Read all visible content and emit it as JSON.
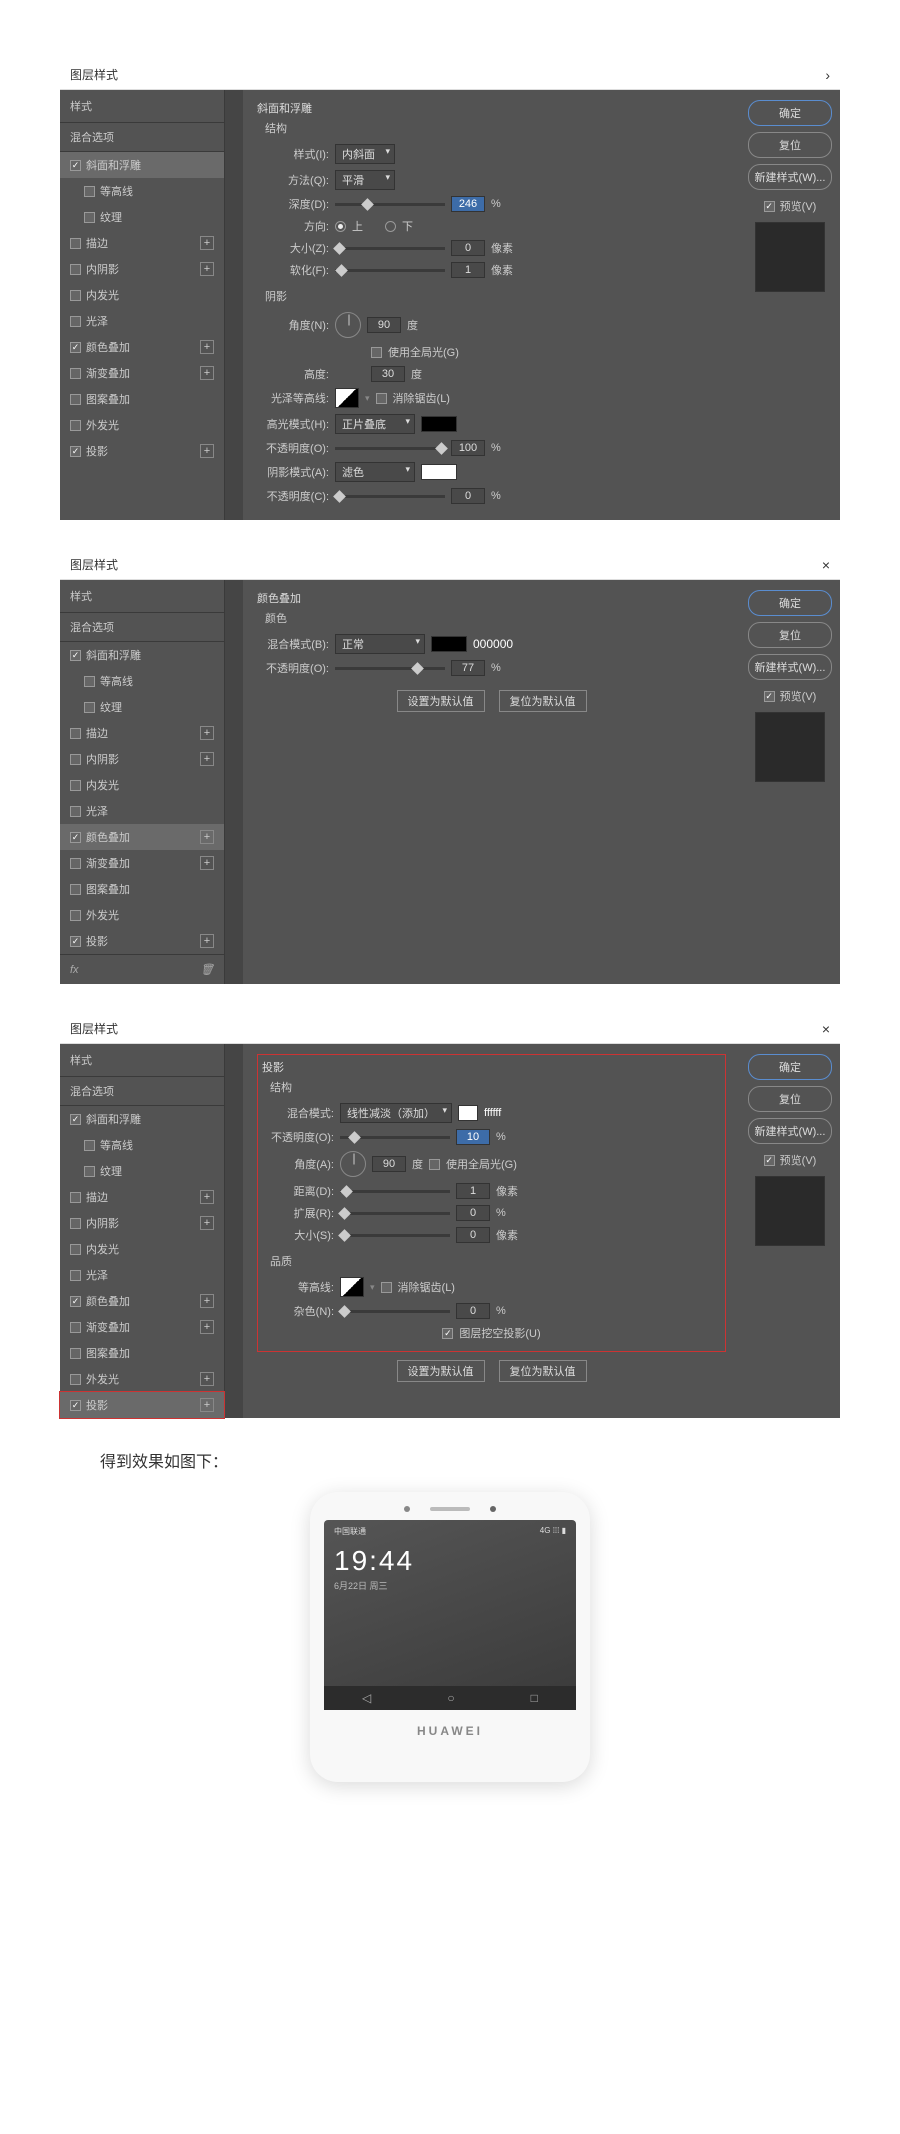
{
  "dialog1": {
    "title": "图层样式",
    "styles_header": "样式",
    "blend_options": "混合选项",
    "items": [
      {
        "label": "斜面和浮雕",
        "checked": true,
        "selected": true
      },
      {
        "label": "等高线",
        "checked": false,
        "indent": true
      },
      {
        "label": "纹理",
        "checked": false,
        "indent": true
      },
      {
        "label": "描边",
        "checked": false,
        "add": true
      },
      {
        "label": "内阴影",
        "checked": false,
        "add": true
      },
      {
        "label": "内发光",
        "checked": false
      },
      {
        "label": "光泽",
        "checked": false
      },
      {
        "label": "颜色叠加",
        "checked": true,
        "add": true
      },
      {
        "label": "渐变叠加",
        "checked": false,
        "add": true
      },
      {
        "label": "图案叠加",
        "checked": false
      },
      {
        "label": "外发光",
        "checked": false
      },
      {
        "label": "投影",
        "checked": true,
        "add": true
      }
    ],
    "panel_title": "斜面和浮雕",
    "structure_label": "结构",
    "style_label": "样式(I):",
    "style_value": "内斜面",
    "method_label": "方法(Q):",
    "method_value": "平滑",
    "depth_label": "深度(D):",
    "depth_value": "246",
    "depth_unit": "%",
    "direction_label": "方向:",
    "dir_up": "上",
    "dir_down": "下",
    "size_label": "大小(Z):",
    "size_value": "0",
    "size_unit": "像素",
    "soften_label": "软化(F):",
    "soften_value": "1",
    "soften_unit": "像素",
    "shadow_section": "阴影",
    "angle_label": "角度(N):",
    "angle_value": "90",
    "angle_unit": "度",
    "global_light": "使用全局光(G)",
    "altitude_label": "高度:",
    "altitude_value": "30",
    "altitude_unit": "度",
    "gloss_label": "光泽等高线:",
    "antialias": "消除锯齿(L)",
    "highlight_mode_label": "高光模式(H):",
    "highlight_mode_value": "正片叠底",
    "highlight_opacity_label": "不透明度(O):",
    "highlight_opacity_value": "100",
    "percent": "%",
    "shadow_mode_label": "阴影模式(A):",
    "shadow_mode_value": "滤色",
    "shadow_opacity_label": "不透明度(C):",
    "shadow_opacity_value": "0"
  },
  "dialog2": {
    "title": "图层样式",
    "items": [
      {
        "label": "斜面和浮雕",
        "checked": true
      },
      {
        "label": "等高线",
        "checked": false,
        "indent": true
      },
      {
        "label": "纹理",
        "checked": false,
        "indent": true
      },
      {
        "label": "描边",
        "checked": false,
        "add": true
      },
      {
        "label": "内阴影",
        "checked": false,
        "add": true
      },
      {
        "label": "内发光",
        "checked": false
      },
      {
        "label": "光泽",
        "checked": false
      },
      {
        "label": "颜色叠加",
        "checked": true,
        "selected": true,
        "add": true
      },
      {
        "label": "渐变叠加",
        "checked": false,
        "add": true
      },
      {
        "label": "图案叠加",
        "checked": false
      },
      {
        "label": "外发光",
        "checked": false
      },
      {
        "label": "投影",
        "checked": true,
        "add": true
      }
    ],
    "panel_title": "颜色叠加",
    "color_section": "颜色",
    "blend_mode_label": "混合模式(B):",
    "blend_mode_value": "正常",
    "color_code": "000000",
    "opacity_label": "不透明度(O):",
    "opacity_value": "77",
    "make_default": "设置为默认值",
    "reset_default": "复位为默认值",
    "fx_label": "fx"
  },
  "dialog3": {
    "title": "图层样式",
    "items": [
      {
        "label": "斜面和浮雕",
        "checked": true
      },
      {
        "label": "等高线",
        "checked": false,
        "indent": true
      },
      {
        "label": "纹理",
        "checked": false,
        "indent": true
      },
      {
        "label": "描边",
        "checked": false,
        "add": true
      },
      {
        "label": "内阴影",
        "checked": false,
        "add": true
      },
      {
        "label": "内发光",
        "checked": false
      },
      {
        "label": "光泽",
        "checked": false
      },
      {
        "label": "颜色叠加",
        "checked": true,
        "add": true
      },
      {
        "label": "渐变叠加",
        "checked": false,
        "add": true
      },
      {
        "label": "图案叠加",
        "checked": false
      },
      {
        "label": "外发光",
        "checked": false,
        "add": true
      },
      {
        "label": "投影",
        "checked": true,
        "selected": true,
        "add": true
      }
    ],
    "panel_title": "投影",
    "structure_label": "结构",
    "blend_mode_label": "混合模式:",
    "blend_mode_value": "线性减淡（添加）",
    "color_code": "ffffff",
    "opacity_label": "不透明度(O):",
    "opacity_value": "10",
    "angle_label": "角度(A):",
    "angle_value": "90",
    "angle_unit": "度",
    "global_light": "使用全局光(G)",
    "distance_label": "距离(D):",
    "distance_value": "1",
    "distance_unit": "像素",
    "spread_label": "扩展(R):",
    "spread_value": "0",
    "percent": "%",
    "size_label": "大小(S):",
    "size_value": "0",
    "size_unit": "像素",
    "quality_section": "品质",
    "contour_label": "等高线:",
    "antialias": "消除锯齿(L)",
    "noise_label": "杂色(N):",
    "noise_value": "0",
    "knockout": "图层挖空投影(U)",
    "make_default": "设置为默认值",
    "reset_default": "复位为默认值"
  },
  "buttons": {
    "ok": "确定",
    "cancel": "复位",
    "new_style": "新建样式(W)...",
    "preview": "预览(V)"
  },
  "result_text": "得到效果如图下：",
  "phone": {
    "carrier": "中国联通",
    "signal": "4G ⁞⁞⁞",
    "battery": "▮",
    "time": "19:44",
    "date": "6月22日 周三",
    "nav_back": "◁",
    "nav_home": "○",
    "nav_recent": "□",
    "logo": "HUAWEI"
  }
}
